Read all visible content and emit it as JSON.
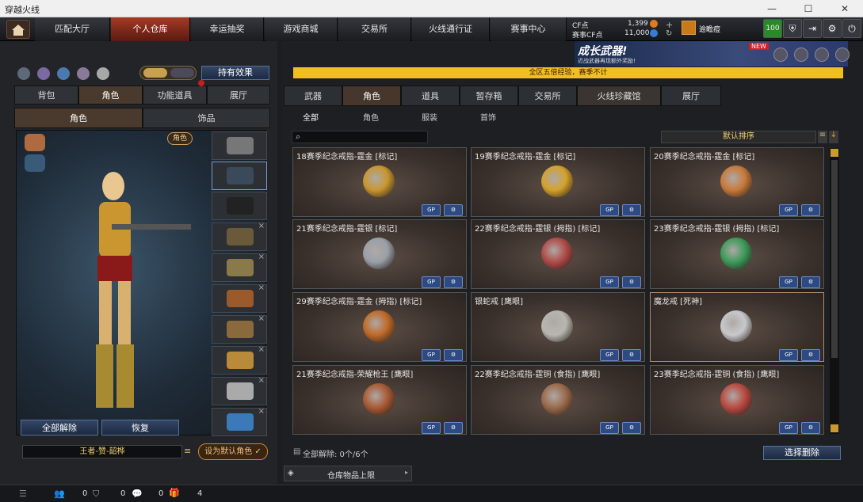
{
  "window": {
    "title": "穿越火线",
    "minimize": "—",
    "maximize": "☐",
    "close": "✕"
  },
  "nav": {
    "tabs": [
      "匹配大厅",
      "个人仓库",
      "幸运抽奖",
      "游戏商城",
      "交易所",
      "火线通行证",
      "赛事中心"
    ],
    "active": 1
  },
  "currency": {
    "cf_label": "CF点",
    "cf_value": "1,399",
    "event_label": "赛事CF点",
    "event_value": "11,000",
    "user": "逾瞻痘",
    "level": "100"
  },
  "banner": {
    "headline": "成长武器!",
    "sub": "近战武器再现额外奖励!",
    "new": "NEW",
    "notice": "全区五倍经验，赛季不计"
  },
  "left": {
    "top_tabs": [
      "背包",
      "角色",
      "功能道具",
      "展厅"
    ],
    "top_active": 1,
    "sub_tabs": [
      "角色",
      "饰品"
    ],
    "sub_active": 0,
    "effect_btn": "持有效果",
    "role_badge": "角色",
    "unequip_all": "全部解除",
    "restore": "恢复",
    "preset_name": "王者-赞-韶桦",
    "set_default": "设为默认角色"
  },
  "right": {
    "tabs": [
      "武器",
      "角色",
      "道具",
      "暂存箱",
      "交易所",
      "火线珍藏馆",
      "展厅"
    ],
    "active": 1,
    "sub_tabs": [
      "全部",
      "角色",
      "服装",
      "首饰"
    ],
    "sub_active": 0,
    "sort": "默认排序",
    "unequip_info": "全部解除: 0个/6个",
    "select_delete": "选择删除",
    "storage_limit": "仓库物品上限"
  },
  "cards": [
    {
      "name": "18赛季纪念戒指-霆金 [标记]",
      "color": "#c9962f"
    },
    {
      "name": "19赛季纪念戒指-霆金 [标记]",
      "color": "#d4a22c"
    },
    {
      "name": "20赛季纪念戒指-霆金 [标记]",
      "color": "#c87a3a"
    },
    {
      "name": "21赛季纪念戒指-霆银 [标记]",
      "color": "#9aa0a8"
    },
    {
      "name": "22赛季纪念戒指-霆银 (拇指) [标记]",
      "color": "#b04b48"
    },
    {
      "name": "23赛季纪念戒指-霆银 (拇指) [标记]",
      "color": "#3c9a5a"
    },
    {
      "name": "29赛季纪念戒指-霆金 (拇指) [标记]",
      "color": "#c06a28"
    },
    {
      "name": "银蛇戒 [鹰眼]",
      "color": "#b8b6b0"
    },
    {
      "name": "魔龙戒 [死神]",
      "color": "#c8c8cc"
    },
    {
      "name": "21赛季纪念戒指-荣耀枪王 [鹰眼]",
      "color": "#a85a34"
    },
    {
      "name": "22赛季纪念戒指-霆铜 (食指) [鹰眼]",
      "color": "#9a6a4a"
    },
    {
      "name": "23赛季纪念戒指-霆铜 (食指) [鹰眼]",
      "color": "#b84a40"
    }
  ],
  "card_btn_gp": "GP",
  "bottom": {
    "count1": "0",
    "count2": "0",
    "count3": "0",
    "count4": "4"
  }
}
